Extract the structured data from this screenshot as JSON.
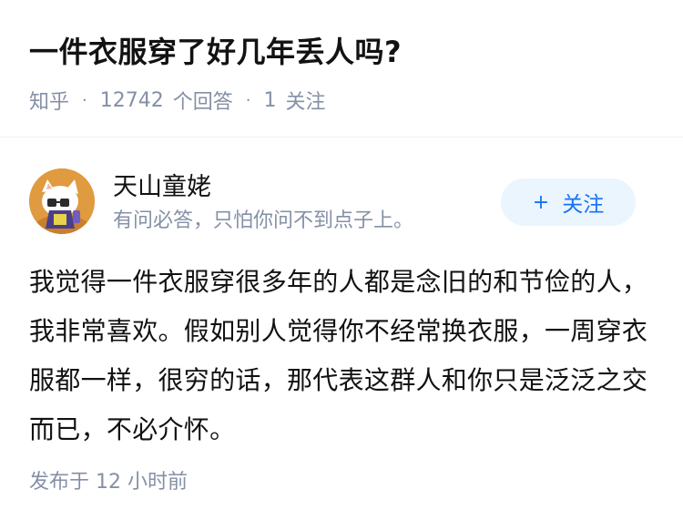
{
  "question": {
    "title": "一件衣服穿了好几年丢人吗?",
    "source": "知乎",
    "answer_count": "12742",
    "answer_label": "个回答",
    "follow_count": "1",
    "follow_label": "关注"
  },
  "author": {
    "name": "天山童姥",
    "bio": "有问必答，只怕你问不到点子上。",
    "follow_button": {
      "icon": "+",
      "label": "关注"
    }
  },
  "answer": {
    "content": "我觉得一件衣服穿很多年的人都是念旧的和节俭的人，我非常喜欢。假如别人觉得你不经常换衣服，一周穿衣服都一样，很穷的话，那代表这群人和你只是泛泛之交而已，不必介怀。",
    "published": "发布于  12 小时前"
  },
  "colors": {
    "title": "#121212",
    "meta": "#8590a6",
    "accent": "#1772f6",
    "follow_bg": "#ebf5fd"
  }
}
